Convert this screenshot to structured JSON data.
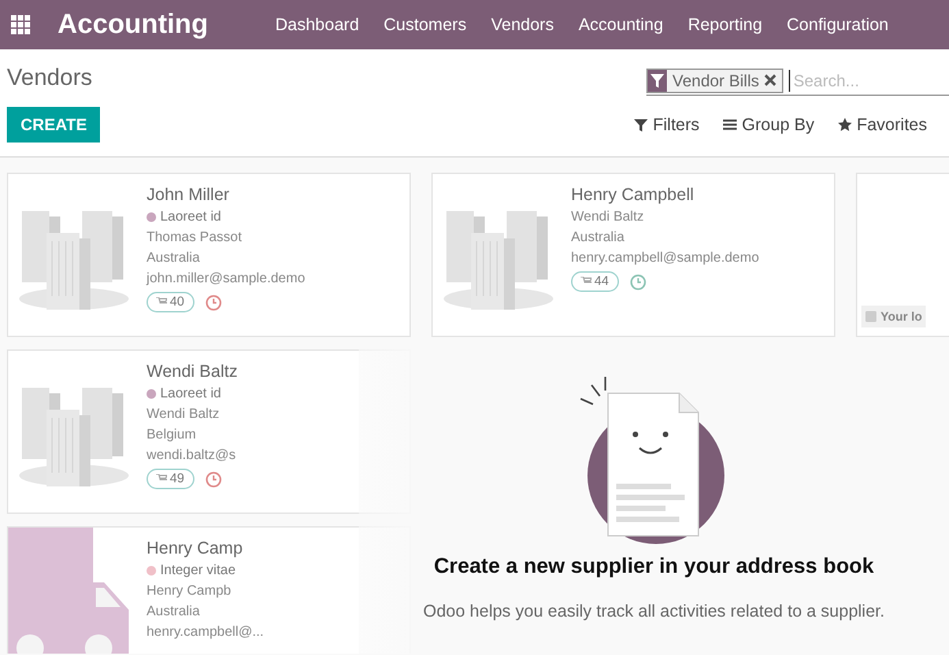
{
  "navbar": {
    "app_name": "Accounting",
    "menu": [
      "Dashboard",
      "Customers",
      "Vendors",
      "Accounting",
      "Reporting",
      "Configuration"
    ]
  },
  "breadcrumb": "Vendors",
  "create_button": "CREATE",
  "search": {
    "facets": [
      {
        "label": "Vendor Bills"
      }
    ],
    "placeholder": "Search..."
  },
  "search_options": [
    {
      "label": "Filters",
      "kind": "filter"
    },
    {
      "label": "Group By",
      "kind": "group"
    },
    {
      "label": "Favorites",
      "kind": "star"
    }
  ],
  "kanban_columns": [
    [
      {
        "kind": "company",
        "name": "John Miller",
        "tag": {
          "label": "Laoreet id",
          "color": "#c9a6bd"
        },
        "lines": [
          "Thomas Passot",
          "Australia",
          "john.miller@sample.demo"
        ],
        "count": "40",
        "activity_overdue": true
      },
      {
        "kind": "company",
        "name": "Wendi Baltz",
        "tag": {
          "label": "Laoreet id",
          "color": "#c9a6bd"
        },
        "lines": [
          "Wendi Baltz",
          "Belgium",
          "wendi.baltz@s"
        ],
        "count": "49",
        "activity_overdue": true
      },
      {
        "kind": "truck",
        "name": "Henry Camp",
        "tag": {
          "label": "Integer vitae",
          "color": "#f0c0c8"
        },
        "lines": [
          "Henry Campb",
          "Australia",
          "henry.campbell@..."
        ]
      }
    ],
    [
      {
        "kind": "company",
        "name": "Henry Campbell",
        "lines": [
          "Wendi Baltz",
          "Australia",
          "henry.campbell@sample.demo"
        ],
        "count": "44",
        "activity_overdue": false
      }
    ],
    [
      {
        "kind": "person",
        "badge": "Your lo"
      }
    ]
  ],
  "helper": {
    "title": "Create a new supplier in your address book",
    "text": "Odoo helps you easily track all activities related to a supplier."
  }
}
